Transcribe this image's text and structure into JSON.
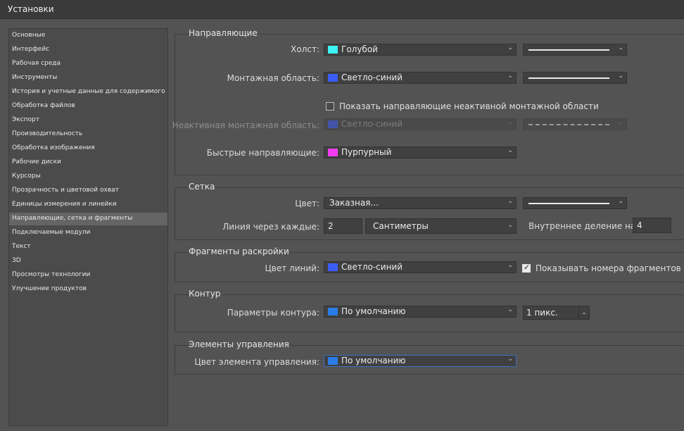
{
  "window": {
    "title": "Установки"
  },
  "sidebar": {
    "items": [
      "Основные",
      "Интерфейс",
      "Рабочая среда",
      "Инструменты",
      "История и учетные данные для содержимого",
      "Обработка файлов",
      "Экспорт",
      "Производительность",
      "Обработка изображения",
      "Рабочие диски",
      "Курсоры",
      "Прозрачность и цветовой охват",
      "Единицы измерения и линейки",
      "Направляющие, сетка и фрагменты",
      "Подключаемые модули",
      "Текст",
      "3D",
      "Просмотры технологии",
      "Улучшение продуктов"
    ],
    "selected_index": 13
  },
  "guides": {
    "title": "Направляющие",
    "canvas_label": "Холст:",
    "canvas_color": "Голубой",
    "canvas_swatch": "#3ef4f4",
    "artboard_label": "Монтажная область:",
    "artboard_color": "Светло-синий",
    "artboard_swatch": "#3a5cf6",
    "show_inactive_label": "Показать направляющие неактивной монтажной области",
    "inactive_label": "Неактивная монтажная область:",
    "inactive_color": "Светло-синий",
    "inactive_swatch": "#3a5cf6",
    "smart_label": "Быстрые направляющие:",
    "smart_color": "Пурпурный",
    "smart_swatch": "#f43cf0"
  },
  "grid": {
    "title": "Сетка",
    "color_label": "Цвет:",
    "color_value": "Заказная...",
    "every_label": "Линия через каждые:",
    "every_value": "2",
    "units_value": "Сантиметры",
    "subdivisions_label": "Внутреннее деление на:",
    "subdivisions_value": "4"
  },
  "slices": {
    "title": "Фрагменты раскройки",
    "line_color_label": "Цвет линий:",
    "line_color_value": "Светло-синий",
    "line_color_swatch": "#3a5cf6",
    "show_numbers_label": "Показывать номера фрагментов",
    "show_numbers_checked": true
  },
  "path": {
    "title": "Контур",
    "options_label": "Параметры контура:",
    "options_value": "По умолчанию",
    "options_swatch": "#2a7de6",
    "width_value": "1 пикс."
  },
  "controls": {
    "title": "Элементы управления",
    "color_label": "Цвет элемента управления:",
    "color_value": "По умолчанию",
    "color_swatch": "#2a7de6"
  }
}
